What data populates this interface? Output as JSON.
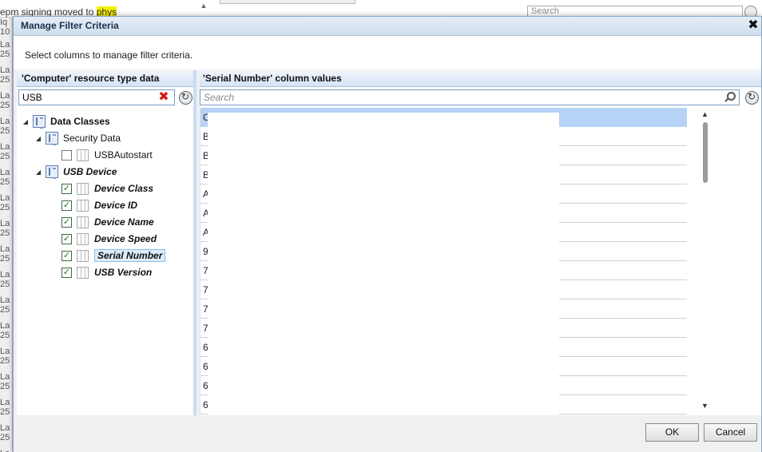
{
  "background": {
    "title_text": "epm signing moved to ",
    "title_highlight": "phys",
    "search_placeholder": "Search",
    "left_fragments": [
      "Iq",
      "10",
      "La",
      "25",
      "La",
      "25",
      "La",
      "25",
      "La",
      "25",
      "La",
      "25",
      "La",
      "25",
      "La",
      "25",
      "La",
      "25",
      "La",
      "25",
      "La",
      "25",
      "La",
      "25",
      "La",
      "25",
      "La",
      "25",
      "La",
      "25",
      "La",
      "25",
      "La",
      "25",
      "La",
      "25"
    ]
  },
  "dialog": {
    "title": "Manage Filter Criteria",
    "close_symbol": "✖",
    "instruction": "Select columns to manage filter criteria."
  },
  "left_pane": {
    "header": "'Computer' resource type data",
    "search_value": "USB",
    "clear_symbol": "✖",
    "tree": {
      "root": {
        "label": "Data Classes",
        "expanded": true
      },
      "security_data": {
        "label": "Security Data",
        "expanded": true
      },
      "usb_autostart": {
        "label": "USBAutostart",
        "checked": false
      },
      "usb_device": {
        "label": "USB Device",
        "expanded": true
      },
      "device_class": {
        "label": "Device Class",
        "checked": true
      },
      "device_id": {
        "label": "Device ID",
        "checked": true
      },
      "device_name": {
        "label": "Device Name",
        "checked": true
      },
      "device_speed": {
        "label": "Device Speed",
        "checked": true
      },
      "serial_number": {
        "label": "Serial Number",
        "checked": true,
        "selected": true
      },
      "usb_version": {
        "label": "USB Version",
        "checked": true
      }
    }
  },
  "right_pane": {
    "header": "'Serial Number' column values",
    "search_placeholder": "Search",
    "values": [
      "C",
      "B",
      "B",
      "B",
      "A",
      "A",
      "A",
      "9",
      "7",
      "7",
      "7",
      "7",
      "6",
      "6",
      "6",
      "6"
    ],
    "selected_index": 0
  },
  "footer": {
    "ok_label": "OK",
    "cancel_label": "Cancel"
  },
  "colors": {
    "selected_row": "#b6d2f4",
    "check_green": "#1a7a1a",
    "clear_red": "#d21a1a"
  }
}
